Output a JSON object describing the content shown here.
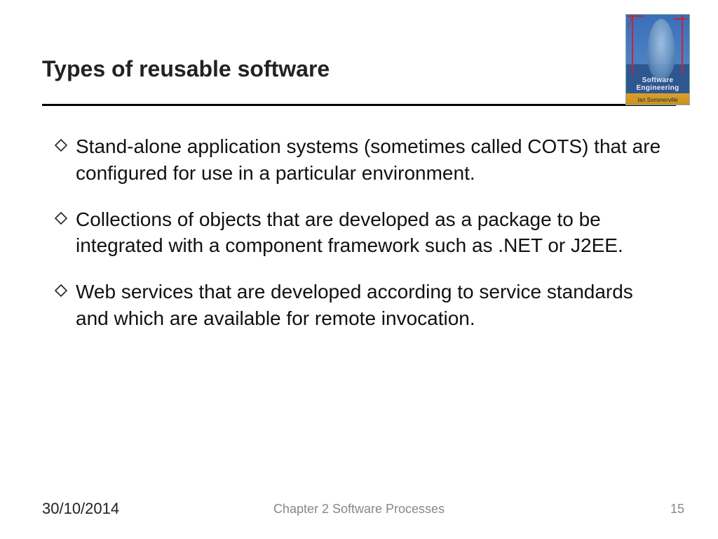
{
  "title": "Types of reusable software",
  "book": {
    "title_line": "Software Engineering",
    "author_line": "Ian Sommerville"
  },
  "bullets": [
    "Stand-alone application systems (sometimes called COTS) that are configured for use in a particular environment.",
    "Collections of objects that are developed as a package to be integrated with a component framework such as .NET or J2EE.",
    "Web services that are developed according to service standards and which are available for remote invocation."
  ],
  "footer": {
    "date": "30/10/2014",
    "chapter": "Chapter 2 Software Processes",
    "page": "15"
  }
}
